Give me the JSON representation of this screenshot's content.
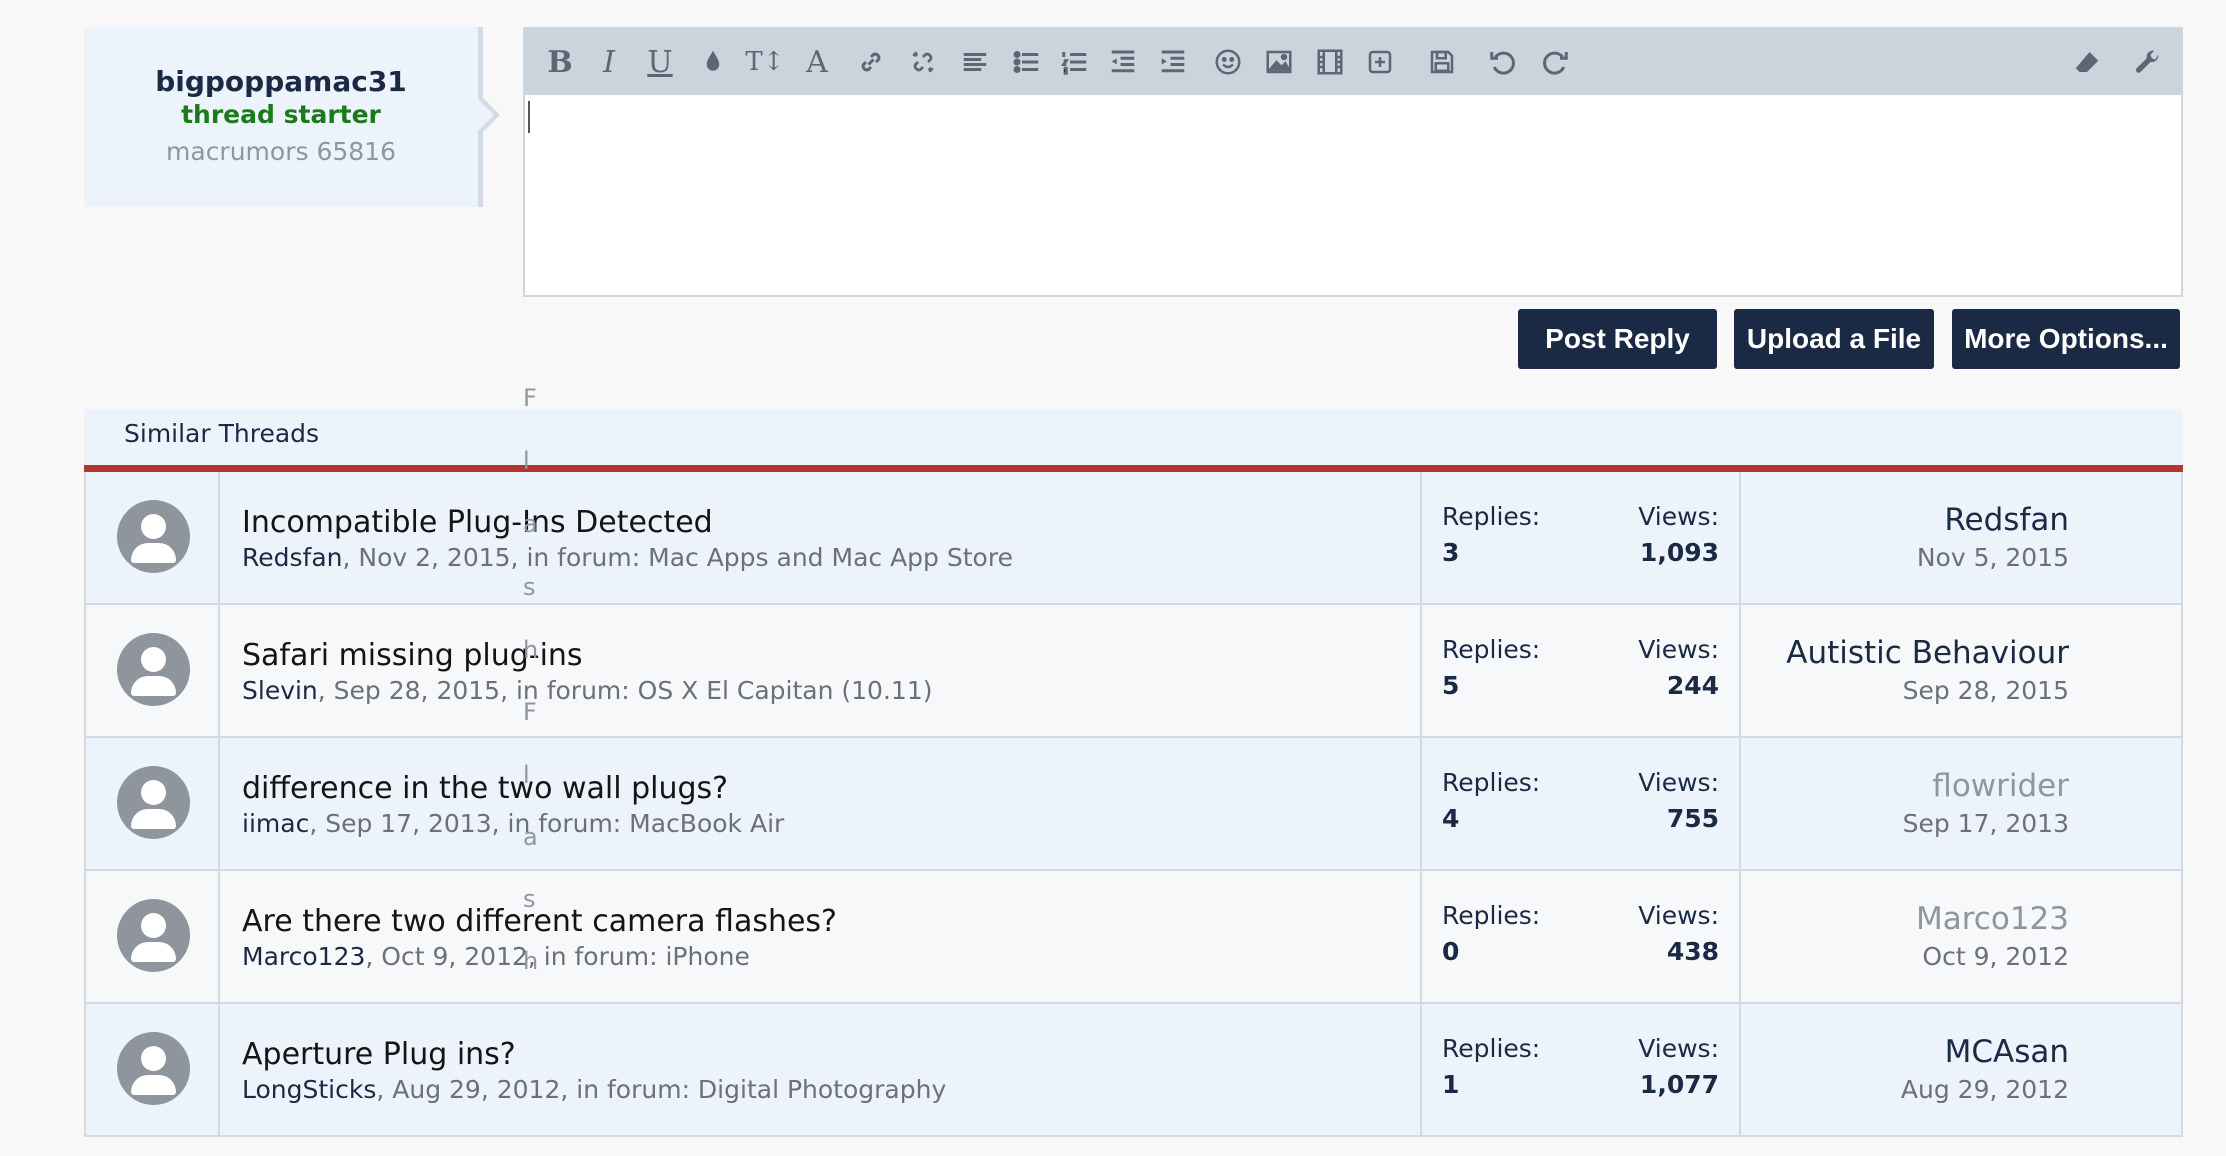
{
  "user_card": {
    "username": "bigpoppamac31",
    "role": "thread starter",
    "title": "macrumors 65816"
  },
  "toolbar": {
    "buttons": [
      "bold",
      "italic",
      "underline",
      "text-color",
      "font-size",
      "font-family",
      "link",
      "unlink",
      "align",
      "bullet-list",
      "numbered-list",
      "outdent",
      "indent",
      "smilies",
      "image",
      "media",
      "insert",
      "save-draft",
      "undo",
      "redo",
      "remove-formatting",
      "toggle-bb-code"
    ]
  },
  "actions": {
    "post_reply": "Post Reply",
    "upload_file": "Upload a File",
    "more_options": "More Options..."
  },
  "overlay_letters": [
    "F",
    "l",
    "a",
    "s",
    "h",
    "F",
    "l",
    "a",
    "s",
    "h"
  ],
  "similar_threads": {
    "heading": "Similar Threads",
    "replies_label": "Replies:",
    "views_label": "Views:",
    "threads": [
      {
        "title": "Incompatible Plug-Ins Detected",
        "author": "Redsfan",
        "meta": ", Nov 2, 2015, in forum: Mac Apps and Mac App Store",
        "replies": "3",
        "views": "1,093",
        "last_user": "Redsfan",
        "last_date": "Nov 5, 2015",
        "muted": false
      },
      {
        "title": "Safari missing plug-ins",
        "author": "Slevin",
        "meta": ", Sep 28, 2015, in forum: OS X El Capitan (10.11)",
        "replies": "5",
        "views": "244",
        "last_user": "Autistic Behaviour",
        "last_date": "Sep 28, 2015",
        "muted": false
      },
      {
        "title": "difference in the two wall plugs?",
        "author": "iimac",
        "meta": ", Sep 17, 2013, in forum: MacBook Air",
        "replies": "4",
        "views": "755",
        "last_user": "flowrider",
        "last_date": "Sep 17, 2013",
        "muted": true
      },
      {
        "title": "Are there two different camera flashes?",
        "author": "Marco123",
        "meta": ", Oct 9, 2012, in forum: iPhone",
        "replies": "0",
        "views": "438",
        "last_user": "Marco123",
        "last_date": "Oct 9, 2012",
        "muted": true
      },
      {
        "title": "Aperture Plug ins?",
        "author": "LongSticks",
        "meta": ", Aug 29, 2012, in forum: Digital Photography",
        "replies": "1",
        "views": "1,077",
        "last_user": "MCAsan",
        "last_date": "Aug 29, 2012",
        "muted": false
      }
    ]
  }
}
